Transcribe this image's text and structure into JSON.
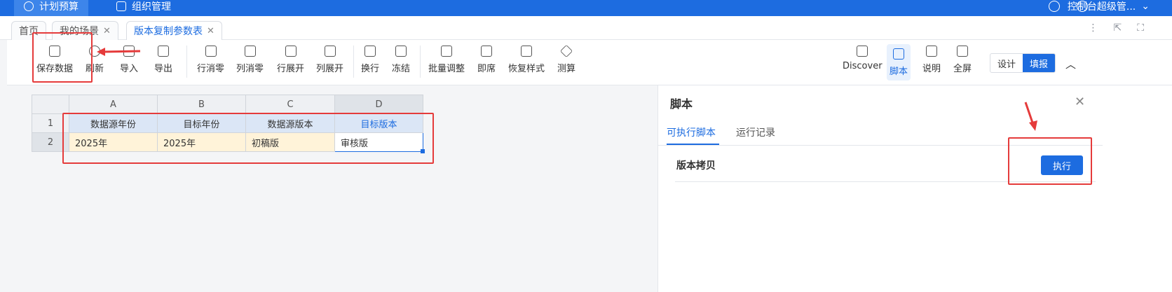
{
  "topbar": {
    "nav": [
      "计划预算",
      "组织管理"
    ],
    "user": "控制台超级管..."
  },
  "tabs": [
    {
      "label": "首页"
    },
    {
      "label": "我的场景"
    },
    {
      "label": "版本复制参数表"
    }
  ],
  "toolbar": {
    "items": [
      "保存数据",
      "刷新",
      "导入",
      "导出",
      "行消零",
      "列消零",
      "行展开",
      "列展开",
      "换行",
      "冻结",
      "批量调整",
      "即席",
      "恢复样式",
      "测算"
    ],
    "right_items": [
      "Discover",
      "脚本",
      "说明",
      "全屏"
    ],
    "mode_design": "设计",
    "mode_fill": "填报"
  },
  "sheet": {
    "columns": [
      "A",
      "B",
      "C",
      "D"
    ],
    "rows": [
      "1",
      "2"
    ],
    "header_cells": [
      "数据源年份",
      "目标年份",
      "数据源版本",
      "目标版本"
    ],
    "value_cells": [
      "2025年",
      "2025年",
      "初稿版",
      "审核版"
    ]
  },
  "panel": {
    "title": "脚本",
    "tabs": [
      "可执行脚本",
      "运行记录"
    ],
    "script_name": "版本拷贝",
    "run_label": "执行"
  },
  "colors": {
    "accent": "#1d6ce0",
    "annotation": "#e53b3b"
  }
}
